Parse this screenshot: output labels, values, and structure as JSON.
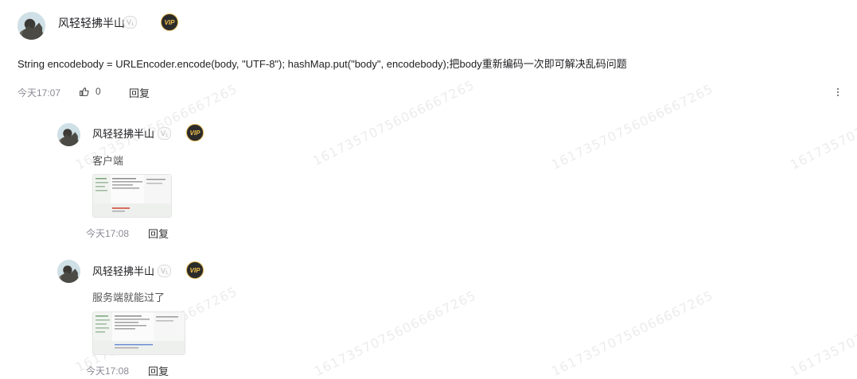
{
  "watermark": "16173570756066667265",
  "main_comment": {
    "author": "风轻轻拂半山",
    "level": "V₁",
    "vip": "VIP",
    "text": "String encodebody = URLEncoder.encode(body, \"UTF-8\"); hashMap.put(\"body\", encodebody);把body重新编码一次即可解决乱码问题",
    "time": "今天17:07",
    "likes": "0",
    "reply_label": "回复"
  },
  "replies": [
    {
      "author": "风轻轻拂半山",
      "level": "V₁",
      "vip": "VIP",
      "text": "客户端",
      "time": "今天17:08",
      "reply_label": "回复"
    },
    {
      "author": "风轻轻拂半山",
      "level": "V₁",
      "vip": "VIP",
      "text": "服务端就能过了",
      "time": "今天17:08",
      "reply_label": "回复"
    }
  ],
  "icons": {
    "like": "thumbs-up-icon",
    "more": "vertical-ellipsis-icon",
    "level_badge": "level-badge-icon",
    "vip_badge": "vip-badge-icon"
  }
}
